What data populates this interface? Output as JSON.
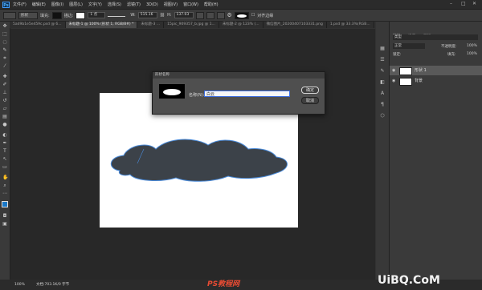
{
  "menu": {
    "logo": "Ps",
    "items": [
      "文件(F)",
      "编辑(E)",
      "图像(I)",
      "图层(L)",
      "文字(Y)",
      "选择(S)",
      "滤镜(T)",
      "3D(D)",
      "视图(V)",
      "窗口(W)",
      "帮助(H)"
    ],
    "window_controls": [
      "–",
      "□",
      "✕"
    ]
  },
  "options_bar": {
    "shape_mode": "形状",
    "fill_label": "填充:",
    "stroke_label": "描边:",
    "stroke_width": "1 点",
    "w_label": "W:",
    "w_value": "515.16",
    "h_label": "H:",
    "h_value": "137.03",
    "align_edges": "对齐边缘"
  },
  "tabs": [
    {
      "label": "5ad9b1e5e459c.psd @ 6...",
      "active": false
    },
    {
      "label": "未标题-1 @ 100% (形状 1, RGB/8#) *",
      "active": true
    },
    {
      "label": "未标题-3 ...",
      "active": false
    },
    {
      "label": "15pic_909357_b.jpg @ 1...",
      "active": false
    },
    {
      "label": "未标题-2 @ 123% (...",
      "active": false
    },
    {
      "label": "微信图片_20200407103331.png",
      "active": false
    },
    {
      "label": "1.psd @ 33.3%(RGB...",
      "active": false
    }
  ],
  "dialog": {
    "title": "形状名称",
    "name_label": "名称(N):",
    "name_value": "白云",
    "ok_label": "确定",
    "cancel_label": "取消"
  },
  "layers_panel": {
    "tabs": [
      "图层",
      "通道",
      "路径"
    ],
    "kind_label": "类型",
    "blend_mode": "正常",
    "opacity_label": "不透明度:",
    "opacity_value": "100%",
    "lock_label": "锁定:",
    "fill_label": "填充:",
    "fill_value": "100%",
    "layers": [
      {
        "name": "形状 1",
        "selected": true
      },
      {
        "name": "背景",
        "selected": false
      }
    ]
  },
  "status_bar": {
    "zoom": "100%",
    "doc_info": "文档:703.1K/0 字节"
  },
  "watermarks": {
    "left": "PS教程网",
    "right": "UiBQ.CoM"
  },
  "colors": {
    "cloud_fill": "#3c4249",
    "cloud_stroke": "#4a8ad8",
    "canvas_bg": "#ffffff",
    "accent": "#3c6de0"
  },
  "tools": [
    "move-icon",
    "marquee-icon",
    "lasso-icon",
    "quick-select-icon",
    "crop-icon",
    "eyedropper-icon",
    "healing-icon",
    "brush-icon",
    "stamp-icon",
    "history-brush-icon",
    "eraser-icon",
    "gradient-icon",
    "blur-icon",
    "dodge-icon",
    "pen-icon",
    "type-icon",
    "path-select-icon",
    "shape-icon",
    "hand-icon",
    "zoom-icon",
    "more-icon",
    "color-swatch-icon",
    "quickmask-icon",
    "screenmode-icon"
  ]
}
